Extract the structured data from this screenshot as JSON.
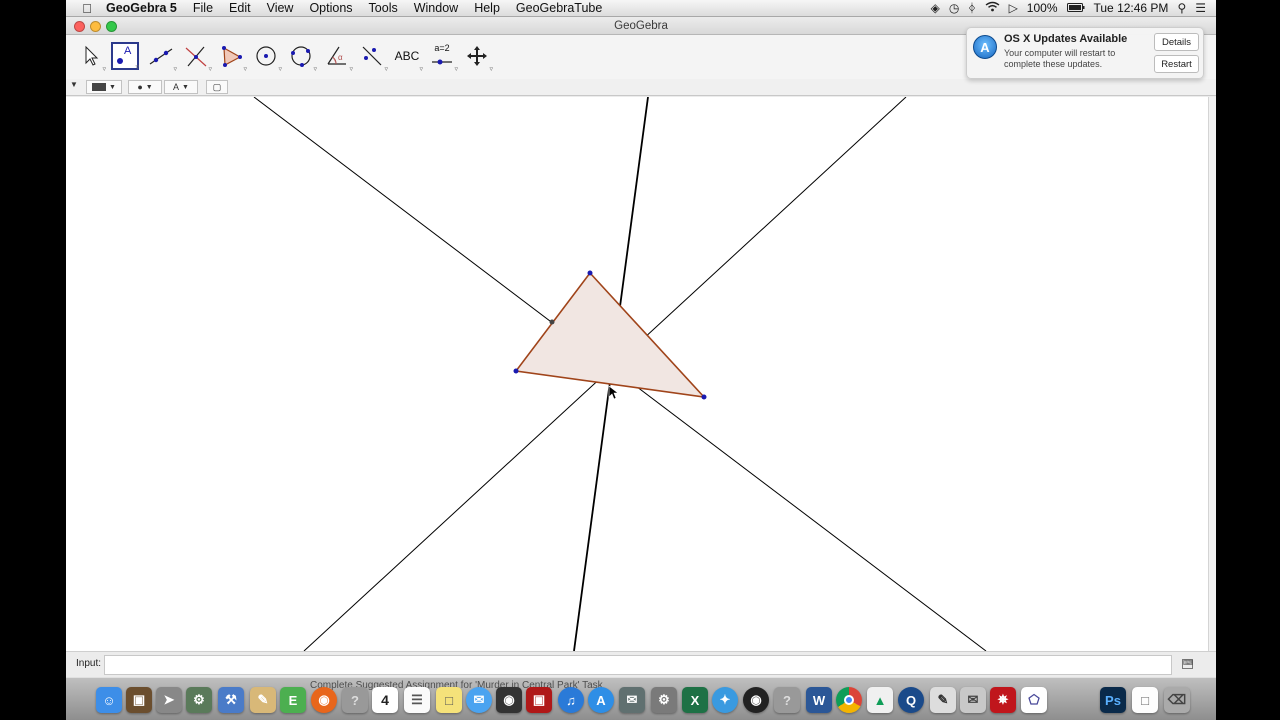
{
  "menubar": {
    "apple_icon": "apple-logo-icon",
    "items": [
      "GeoGebra 5",
      "File",
      "Edit",
      "View",
      "Options",
      "Tools",
      "Window",
      "Help",
      "GeoGebraTube"
    ],
    "status": {
      "battery_percent": "100%",
      "clock": "Tue 12:46 PM",
      "icons": [
        "dropbox-icon",
        "time-machine-icon",
        "bluetooth-icon",
        "wifi-icon",
        "volume-icon",
        "battery-icon",
        "spotlight-icon",
        "notification-center-icon"
      ]
    }
  },
  "window": {
    "title": "GeoGebra"
  },
  "toolbar": {
    "tools": [
      {
        "name": "move-tool"
      },
      {
        "name": "point-tool"
      },
      {
        "name": "line-tool"
      },
      {
        "name": "perpendicular-line-tool"
      },
      {
        "name": "polygon-tool"
      },
      {
        "name": "circle-center-point-tool"
      },
      {
        "name": "circle-through-three-points-tool"
      },
      {
        "name": "angle-tool"
      },
      {
        "name": "reflect-about-line-tool"
      },
      {
        "name": "text-tool",
        "label": "ABC"
      },
      {
        "name": "slider-tool",
        "label": "a=2"
      },
      {
        "name": "move-graphics-view-tool"
      }
    ],
    "stylebar": {
      "text_style_label": "A"
    }
  },
  "notification": {
    "title": "OS X Updates Available",
    "body": "Your computer will restart to complete these updates.",
    "details_button": "Details",
    "restart_button": "Restart",
    "icon": "app-store-icon"
  },
  "input_bar": {
    "label": "Input:",
    "value": "",
    "keyboard_icon": "virtual-keyboard-icon"
  },
  "geometry": {
    "colors": {
      "polygon_fill": "#f1e6e2",
      "polygon_stroke": "#a0441a",
      "point": "#1a1ab0",
      "line": "#000000",
      "intersection_point": "#444444"
    }
  },
  "dock": {
    "hover_label": "Complete Suggested Assignment for 'Murder in Central Park' Task",
    "calendar_day": "4",
    "apps": [
      "finder",
      "preview",
      "launchpad",
      "system-prefs",
      "xcode",
      "notes-app",
      "evernote",
      "firefox",
      "unknown",
      "calendar",
      "textedit",
      "stickies",
      "messages",
      "facetime",
      "photo-booth",
      "itunes",
      "app-store",
      "mail",
      "gears",
      "excel",
      "safari",
      "dvd-player",
      "unknown",
      "word",
      "chrome",
      "google-drive",
      "quicktime",
      "sketch",
      "mail-send",
      "acrobat",
      "geogebra",
      "photoshop",
      "document",
      "trash"
    ]
  }
}
